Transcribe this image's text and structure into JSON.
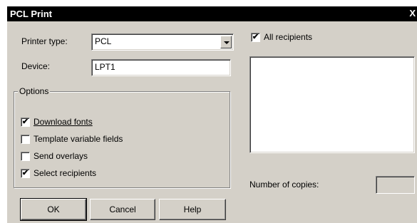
{
  "window": {
    "title": "PCL Print",
    "close_glyph": "X"
  },
  "form": {
    "printer_type_label": "Printer type:",
    "printer_type_value": "PCL",
    "device_label": "Device:",
    "device_value": "LPT1"
  },
  "options": {
    "legend": "Options",
    "items": [
      {
        "label": "Download fonts",
        "checked": true
      },
      {
        "label": "Template variable fields",
        "checked": false
      },
      {
        "label": "Send overlays",
        "checked": false
      },
      {
        "label": "Select recipients",
        "checked": true
      }
    ]
  },
  "recipients": {
    "all_label": "All recipients",
    "all_checked": true,
    "list_items": []
  },
  "copies": {
    "label": "Number of copies:",
    "value": ""
  },
  "buttons": {
    "ok": "OK",
    "cancel": "Cancel",
    "help": "Help"
  },
  "colors": {
    "dialog_bg": "#d4d0c8",
    "titlebar_bg": "#000000",
    "field_bg": "#ffffff"
  },
  "icons": {
    "dropdown": "chevron-down-icon",
    "check": "checkmark-icon",
    "close": "close-icon"
  }
}
